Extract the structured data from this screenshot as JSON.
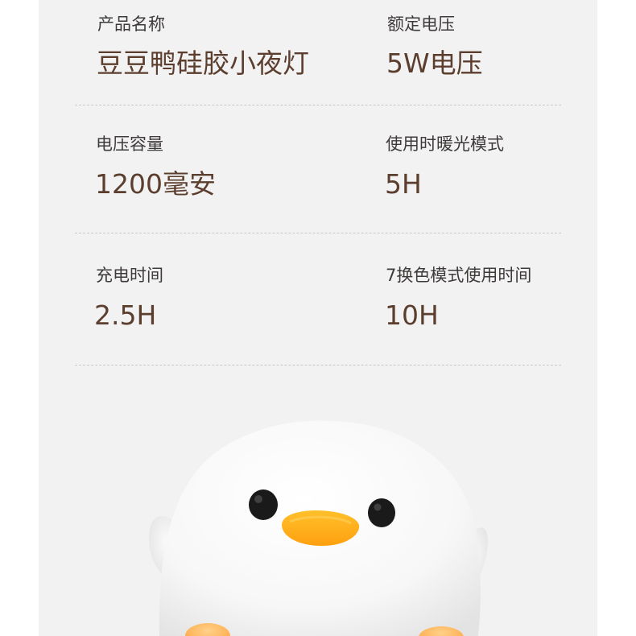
{
  "specs": [
    {
      "label": "产品名称",
      "value": "豆豆鸭硅胶小夜灯"
    },
    {
      "label": "额定电压",
      "value": "5W电压"
    },
    {
      "label": "电压容量",
      "value": "1200毫安"
    },
    {
      "label": "使用时暖光模式",
      "value": "5H"
    },
    {
      "label": "充电时间",
      "value": "2.5H"
    },
    {
      "label": "7换色模式使用时间",
      "value": "10H"
    }
  ],
  "colors": {
    "background": "#f2f2f2",
    "label_text": "#3e3a3a",
    "value_text": "#5c3e2e",
    "beak": "#ffb21a",
    "eyes": "#1a1a1a"
  }
}
